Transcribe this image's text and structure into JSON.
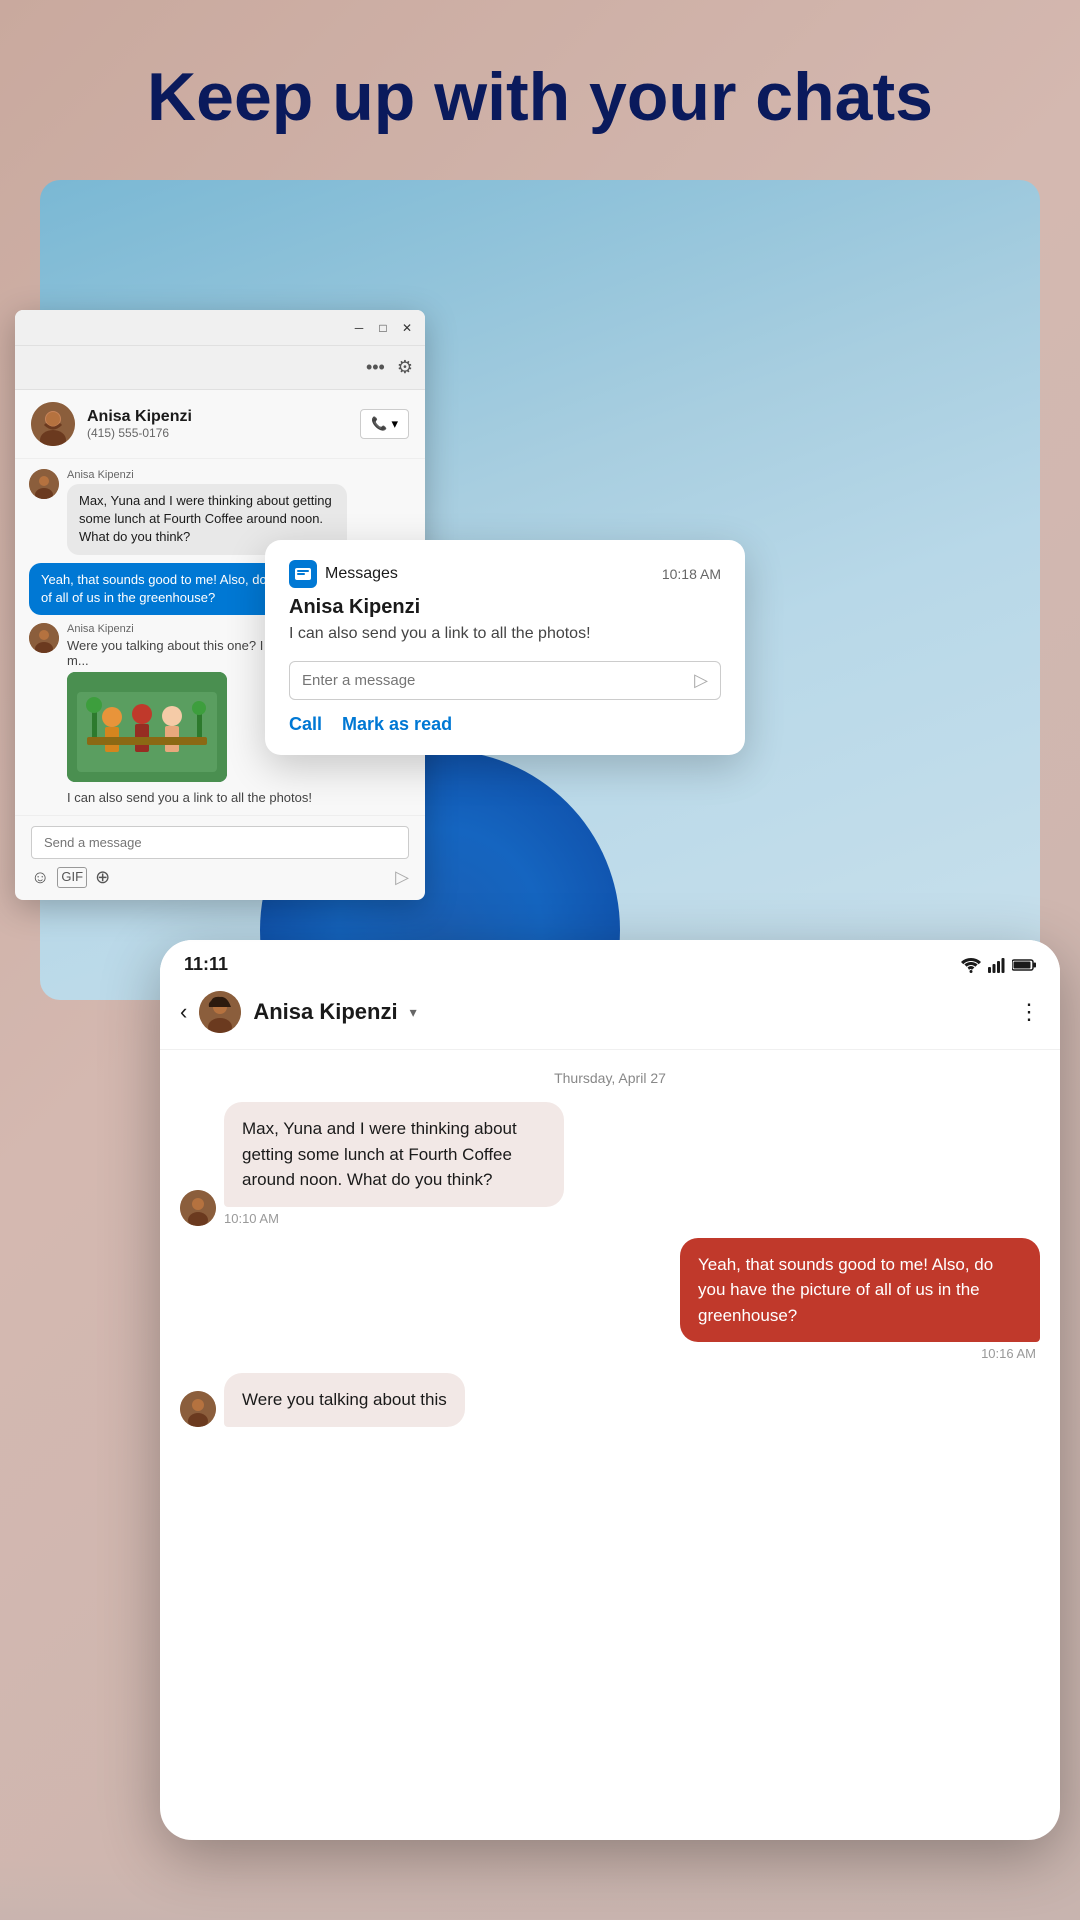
{
  "headline": "Keep up with your chats",
  "windows_app": {
    "contact": {
      "name": "Anisa Kipenzi",
      "phone": "(415) 555-0176"
    },
    "messages": [
      {
        "sender": "Anisa Kipenzi",
        "text": "Max, Yuna and I were thinking about getting some lunch at Fourth Coffee around noon. What do you think?",
        "type": "received"
      },
      {
        "text": "Yeah, that sounds good to me! Also, do you have the picture of all of us in the greenhouse?",
        "type": "sent"
      },
      {
        "sender": "Anisa Kipenzi",
        "text": "Were you talking about this one? I have a few m...",
        "type": "received",
        "has_image": true
      },
      {
        "text": "I can also send you a link to all the photos!",
        "type": "received_plain"
      }
    ],
    "input_placeholder": "Send a message"
  },
  "notification": {
    "app_name": "Messages",
    "time": "10:18 AM",
    "sender": "Anisa Kipenzi",
    "message": "I can also send you a link to all the photos!",
    "input_placeholder": "Enter a message",
    "actions": {
      "call": "Call",
      "mark_as_read": "Mark as read"
    }
  },
  "phone": {
    "status_bar": {
      "time": "11:11"
    },
    "contact_name": "Anisa Kipenzi",
    "date_divider": "Thursday, April 27",
    "messages": [
      {
        "text": "Max, Yuna and I were thinking about getting some lunch at Fourth Coffee around noon. What do you think?",
        "type": "received",
        "time": "10:10 AM"
      },
      {
        "text": "Yeah, that sounds good to me! Also, do you have the picture of all of us in the greenhouse?",
        "type": "sent",
        "time": "10:16 AM"
      },
      {
        "text": "Were you talking about this",
        "type": "received_partial"
      }
    ]
  }
}
